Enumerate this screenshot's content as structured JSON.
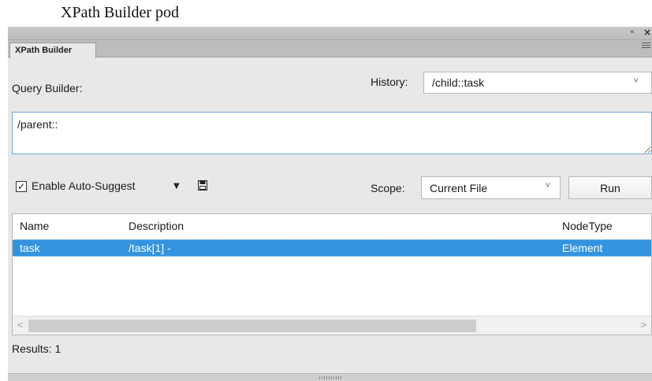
{
  "caption": "XPath Builder pod",
  "panel": {
    "tab_label": "XPath Builder",
    "collapse_glyph": "«",
    "close_glyph": "×"
  },
  "query_builder": {
    "label": "Query Builder:",
    "value": "/parent::"
  },
  "history": {
    "label": "History:",
    "selected": "/child::task"
  },
  "toolbar": {
    "auto_suggest_label": "Enable Auto-Suggest",
    "auto_suggest_checked": true,
    "scope_label": "Scope:",
    "scope_selected": "Current File",
    "run_label": "Run"
  },
  "table": {
    "columns": [
      "Name",
      "Description",
      "NodeType"
    ],
    "rows": [
      {
        "name": "task",
        "description": "/task[1] -",
        "nodetype": "Element"
      }
    ]
  },
  "status": {
    "results_text": "Results: 1"
  },
  "icons": [
    "collapse-icon",
    "close-icon",
    "panel-menu-icon",
    "checkbox-checked-icon",
    "dropdown-arrow-icon",
    "save-icon",
    "chevron-down-icon",
    "scroll-left-icon",
    "scroll-right-icon"
  ],
  "colors": {
    "selection": "#3393df",
    "input_focus_border": "#6fa9dc",
    "panel_bg": "#e8e8e8"
  }
}
